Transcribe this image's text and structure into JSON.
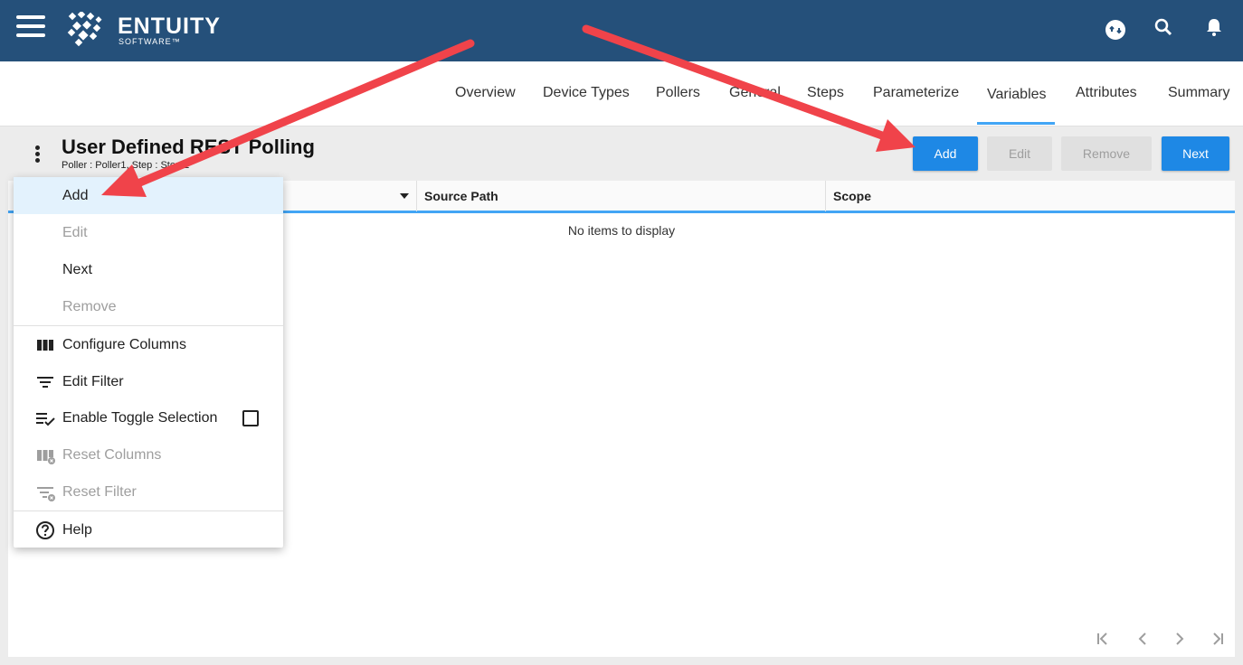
{
  "app": {
    "brand_name": "ENTUITY",
    "brand_sub": "SOFTWARE™",
    "brand_color": "#25507a",
    "accent_color": "#1e88e5",
    "icons": [
      "menu-icon",
      "switch-user-icon",
      "search-icon",
      "notification-bell-icon"
    ]
  },
  "tabs": [
    {
      "label": "Overview"
    },
    {
      "label": "Device Types"
    },
    {
      "label": "Pollers"
    },
    {
      "label": "General"
    },
    {
      "label": "Steps"
    },
    {
      "label": "Parameterize"
    },
    {
      "label": "Variables",
      "selected": true
    },
    {
      "label": "Attributes"
    },
    {
      "label": "Summary"
    }
  ],
  "page": {
    "title": "User Defined REST Polling",
    "subtitle": "Poller : Poller1, Step : Step 2"
  },
  "toolbar": {
    "add_label": "Add",
    "edit_label": "Edit",
    "remove_label": "Remove",
    "next_label": "Next"
  },
  "grid": {
    "columns": [
      "",
      "Source Path",
      "Scope"
    ],
    "empty_message": "No items to display",
    "pager": [
      "first-page-icon",
      "prev-page-icon",
      "next-page-icon",
      "last-page-icon"
    ]
  },
  "menu": {
    "items": [
      {
        "label": "Add",
        "state": "active"
      },
      {
        "label": "Edit",
        "state": "disabled"
      },
      {
        "label": "Next",
        "state": "enabled"
      },
      {
        "label": "Remove",
        "state": "disabled"
      },
      {
        "label": "Configure Columns",
        "icon": "columns-icon"
      },
      {
        "label": "Edit Filter",
        "icon": "filter-icon"
      },
      {
        "label": "Enable Toggle Selection",
        "icon": "toggle-selection-icon",
        "checked": false
      },
      {
        "label": "Reset Columns",
        "icon": "reset-columns-icon",
        "state": "disabled"
      },
      {
        "label": "Reset Filter",
        "icon": "reset-filter-icon",
        "state": "disabled"
      },
      {
        "label": "Help",
        "icon": "help-icon"
      }
    ]
  },
  "annotation_color": "#f0434a"
}
